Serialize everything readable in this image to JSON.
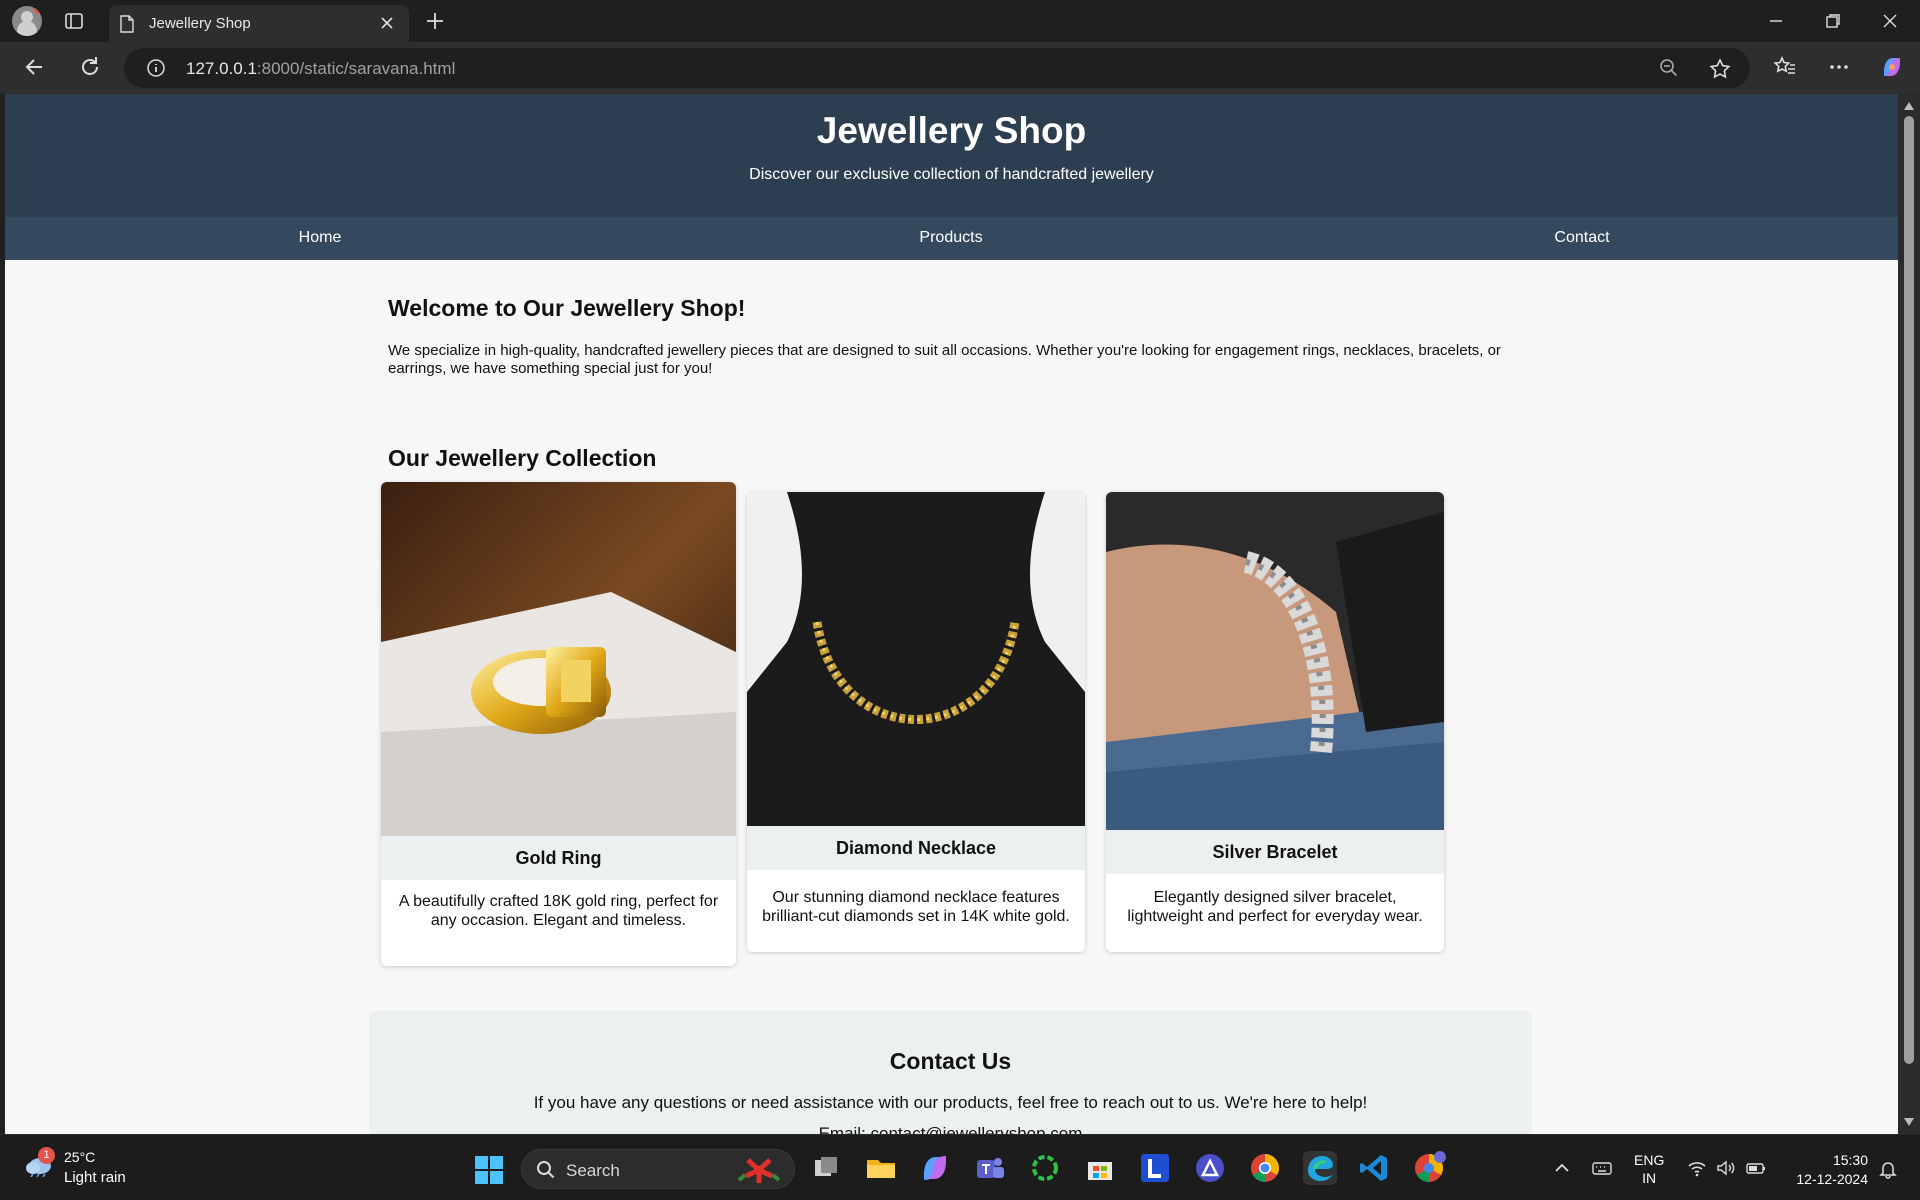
{
  "browser": {
    "tab_title": "Jewellery Shop",
    "url_host": "127.0.0.1",
    "url_rest": ":8000/static/saravana.html"
  },
  "site": {
    "title": "Jewellery Shop",
    "tagline": "Discover our exclusive collection of handcrafted jewellery",
    "nav": [
      {
        "label": "Home"
      },
      {
        "label": "Products"
      },
      {
        "label": "Contact"
      }
    ],
    "welcome_heading": "Welcome to Our Jewellery Shop!",
    "welcome_text": "We specialize in high-quality, handcrafted jewellery pieces that are designed to suit all occasions. Whether you're looking for engagement rings, necklaces, bracelets, or earrings, we have something special just for you!",
    "collection_heading": "Our Jewellery Collection",
    "products": [
      {
        "name": "Gold Ring",
        "description": "A beautifully crafted 18K gold ring, perfect for any occasion. Elegant and timeless."
      },
      {
        "name": "Diamond Necklace",
        "description": "Our stunning diamond necklace features brilliant-cut diamonds set in 14K white gold."
      },
      {
        "name": "Silver Bracelet",
        "description": "Elegantly designed silver bracelet, lightweight and perfect for everyday wear."
      }
    ],
    "contact": {
      "heading": "Contact Us",
      "text": "If you have any questions or need assistance with our products, feel free to reach out to us. We're here to help!",
      "email": "Email: contact@jewelleryshop.com"
    },
    "colors": {
      "header_bg": "#2c3e50",
      "nav_bg": "#34495e",
      "card_title_bg": "#ecf0f1"
    }
  },
  "taskbar": {
    "weather_badge": "1",
    "temperature": "25°C",
    "condition": "Light rain",
    "search_label": "Search",
    "language": "ENG",
    "region": "IN",
    "time": "15:30",
    "date": "12-12-2024"
  }
}
